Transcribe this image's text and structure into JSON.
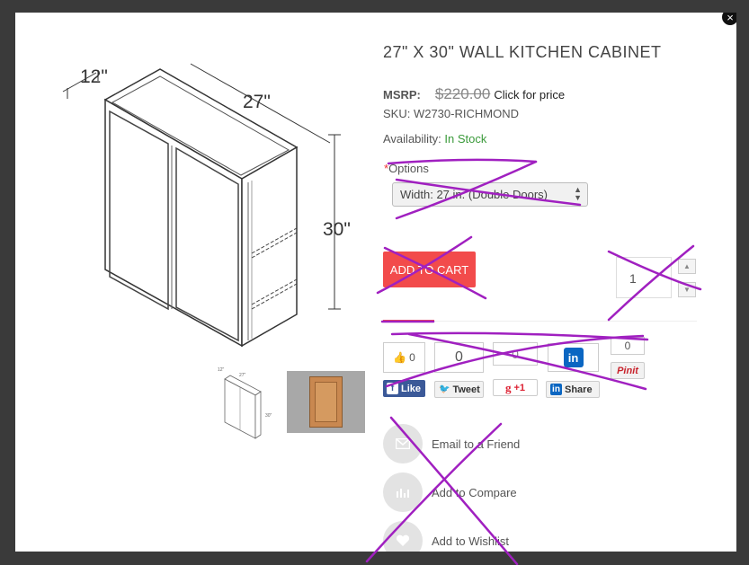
{
  "modal": {
    "close_symbol": "×"
  },
  "diagram": {
    "depth": "12\"",
    "width": "27\"",
    "height": "30\""
  },
  "thumbnail": {
    "depth": "12\"",
    "width": "27\"",
    "height": "30\""
  },
  "product": {
    "title": "27\" X 30\" WALL KITCHEN CABINET",
    "msrp_label": "MSRP:",
    "msrp_value": "$220.00",
    "click_for_price": "Click for price",
    "sku": "SKU: W2730-RICHMOND",
    "availability_label": "Availability:",
    "availability_value": "In Stock"
  },
  "options": {
    "required_mark": "*",
    "label": "Options",
    "selected": "Width: 27 in. (Double Doors)"
  },
  "cart": {
    "add_label": "ADD TO CART",
    "quantity": "1"
  },
  "social": {
    "facebook": {
      "count": "0",
      "label": "Like"
    },
    "twitter": {
      "count": "0",
      "label": "Tweet"
    },
    "google": {
      "count": "0",
      "label": "+1"
    },
    "linkedin": {
      "label": "Share",
      "logo": "in"
    },
    "pinterest": {
      "count": "0",
      "label": "Pinit"
    }
  },
  "actions": [
    {
      "label": "Email to a Friend",
      "icon": "envelope-icon"
    },
    {
      "label": "Add to Compare",
      "icon": "bar-chart-icon"
    },
    {
      "label": "Add to Wishlist",
      "icon": "heart-icon"
    }
  ],
  "colors": {
    "accent": "#f24b4b",
    "in_stock": "#3a9a3a",
    "scribble": "#a020c0",
    "facebook": "#3b5998",
    "linkedin": "#0a66c2"
  }
}
